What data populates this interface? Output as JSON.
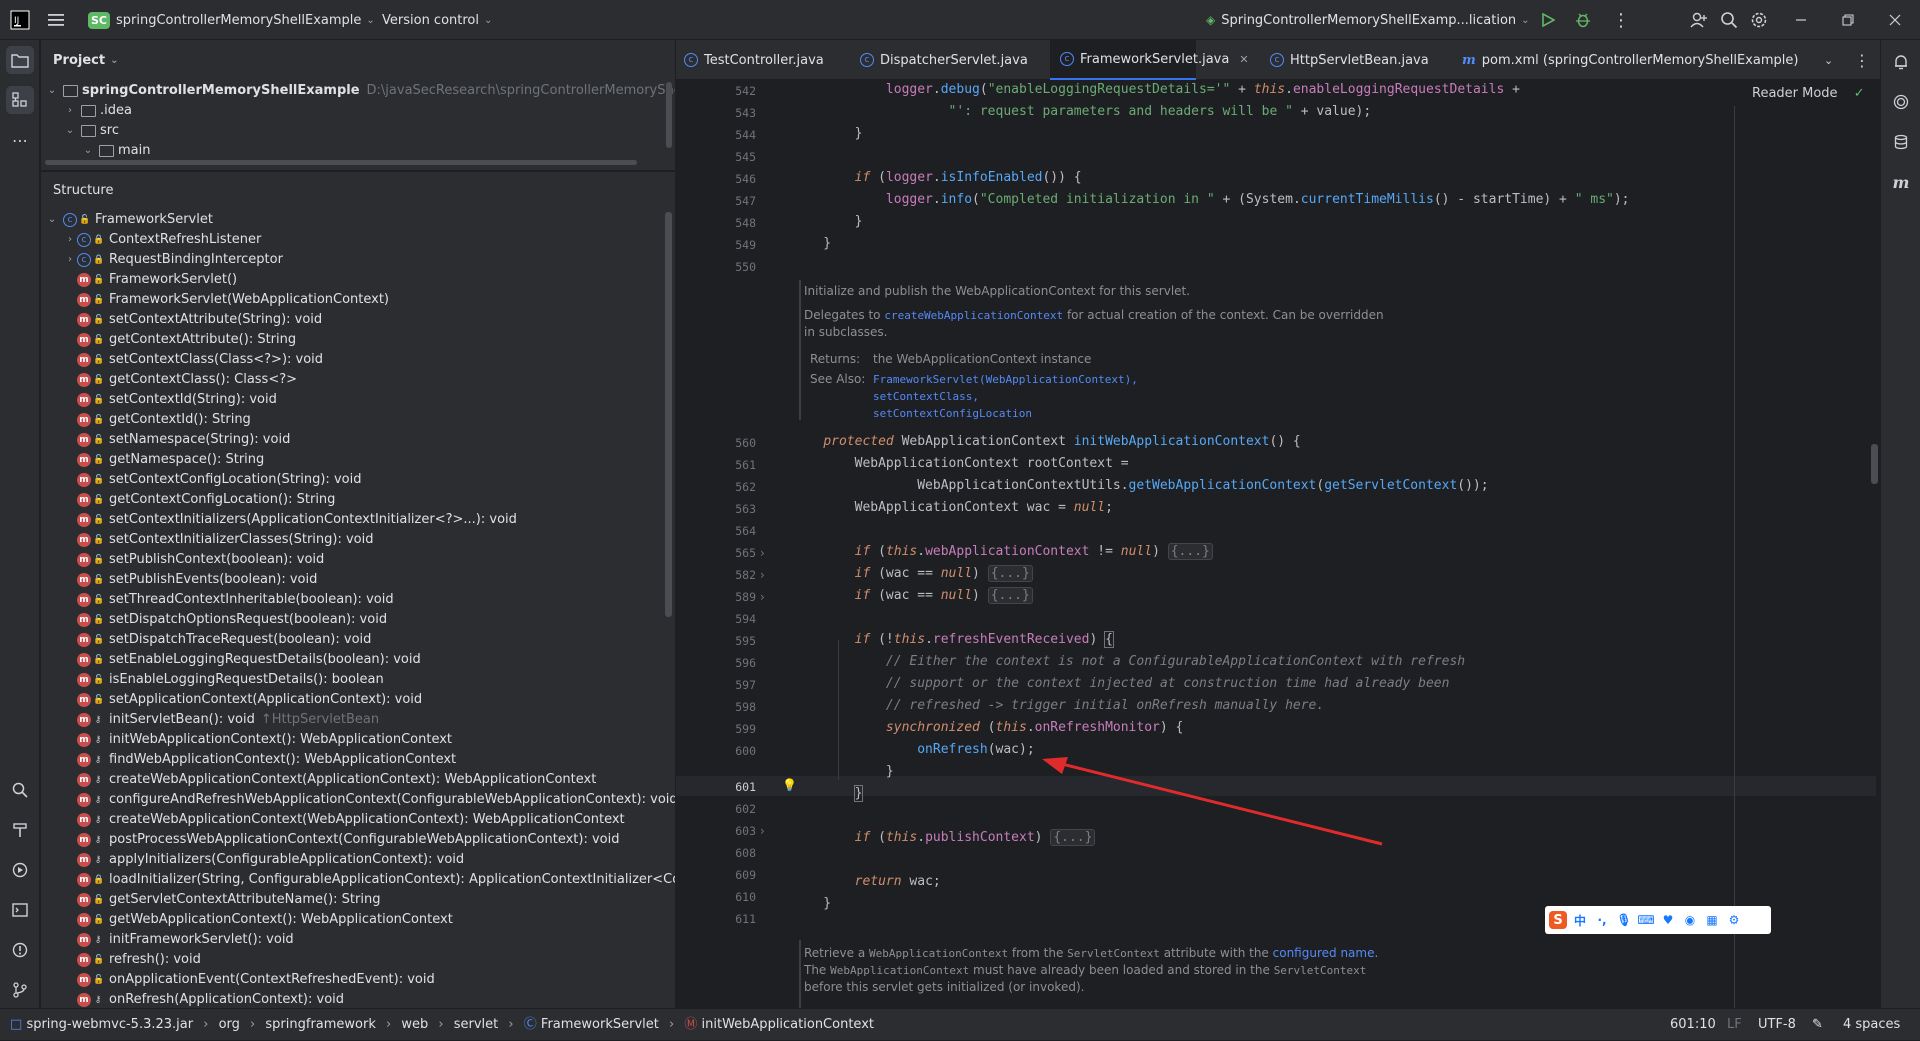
{
  "titlebar": {
    "project_badge": "SC",
    "project_name": "springControllerMemoryShellExample",
    "vcs": "Version control",
    "run_config": "SpringControllerMemoryShellExamp...lication"
  },
  "project_panel": {
    "title": "Project",
    "root_name": "springControllerMemoryShellExample",
    "root_path": "D:\\javaSecResearch\\springControllerMemoryShellExamp",
    "items": [
      ".idea",
      "src",
      "main"
    ]
  },
  "structure_panel": {
    "title": "Structure",
    "root": "FrameworkServlet",
    "items": [
      {
        "text": "ContextRefreshListener",
        "kind": "class",
        "vis": "lock",
        "hint": ""
      },
      {
        "text": "RequestBindingInterceptor",
        "kind": "class",
        "vis": "lock",
        "hint": ""
      },
      {
        "text": "FrameworkServlet()",
        "kind": "method",
        "vis": "open",
        "hint": ""
      },
      {
        "text": "FrameworkServlet(WebApplicationContext)",
        "kind": "method",
        "vis": "open",
        "hint": ""
      },
      {
        "text": "setContextAttribute(String): void",
        "kind": "method",
        "vis": "open",
        "hint": ""
      },
      {
        "text": "getContextAttribute(): String",
        "kind": "method",
        "vis": "open",
        "hint": ""
      },
      {
        "text": "setContextClass(Class<?>): void",
        "kind": "method",
        "vis": "open",
        "hint": ""
      },
      {
        "text": "getContextClass(): Class<?>",
        "kind": "method",
        "vis": "open",
        "hint": ""
      },
      {
        "text": "setContextId(String): void",
        "kind": "method",
        "vis": "open",
        "hint": ""
      },
      {
        "text": "getContextId(): String",
        "kind": "method",
        "vis": "open",
        "hint": ""
      },
      {
        "text": "setNamespace(String): void",
        "kind": "method",
        "vis": "open",
        "hint": ""
      },
      {
        "text": "getNamespace(): String",
        "kind": "method",
        "vis": "open",
        "hint": ""
      },
      {
        "text": "setContextConfigLocation(String): void",
        "kind": "method",
        "vis": "open",
        "hint": ""
      },
      {
        "text": "getContextConfigLocation(): String",
        "kind": "method",
        "vis": "open",
        "hint": ""
      },
      {
        "text": "setContextInitializers(ApplicationContextInitializer<?>...): void",
        "kind": "method",
        "vis": "open",
        "hint": ""
      },
      {
        "text": "setContextInitializerClasses(String): void",
        "kind": "method",
        "vis": "open",
        "hint": ""
      },
      {
        "text": "setPublishContext(boolean): void",
        "kind": "method",
        "vis": "open",
        "hint": ""
      },
      {
        "text": "setPublishEvents(boolean): void",
        "kind": "method",
        "vis": "open",
        "hint": ""
      },
      {
        "text": "setThreadContextInheritable(boolean): void",
        "kind": "method",
        "vis": "open",
        "hint": ""
      },
      {
        "text": "setDispatchOptionsRequest(boolean): void",
        "kind": "method",
        "vis": "open",
        "hint": ""
      },
      {
        "text": "setDispatchTraceRequest(boolean): void",
        "kind": "method",
        "vis": "open",
        "hint": ""
      },
      {
        "text": "setEnableLoggingRequestDetails(boolean): void",
        "kind": "method",
        "vis": "open",
        "hint": ""
      },
      {
        "text": "isEnableLoggingRequestDetails(): boolean",
        "kind": "method",
        "vis": "open",
        "hint": ""
      },
      {
        "text": "setApplicationContext(ApplicationContext): void",
        "kind": "method",
        "vis": "open",
        "hint": ""
      },
      {
        "text": "initServletBean(): void",
        "kind": "method",
        "vis": "key",
        "hint": "↑HttpServletBean"
      },
      {
        "text": "initWebApplicationContext(): WebApplicationContext",
        "kind": "method",
        "vis": "key",
        "hint": ""
      },
      {
        "text": "findWebApplicationContext(): WebApplicationContext",
        "kind": "method",
        "vis": "key",
        "hint": ""
      },
      {
        "text": "createWebApplicationContext(ApplicationContext): WebApplicationContext",
        "kind": "method",
        "vis": "key",
        "hint": ""
      },
      {
        "text": "configureAndRefreshWebApplicationContext(ConfigurableWebApplicationContext): void",
        "kind": "method",
        "vis": "key",
        "hint": ""
      },
      {
        "text": "createWebApplicationContext(WebApplicationContext): WebApplicationContext",
        "kind": "method",
        "vis": "key",
        "hint": ""
      },
      {
        "text": "postProcessWebApplicationContext(ConfigurableWebApplicationContext): void",
        "kind": "method",
        "vis": "key",
        "hint": ""
      },
      {
        "text": "applyInitializers(ConfigurableApplicationContext): void",
        "kind": "method",
        "vis": "key",
        "hint": ""
      },
      {
        "text": "loadInitializer(String, ConfigurableApplicationContext): ApplicationContextInitializer<Conf",
        "kind": "method",
        "vis": "lock",
        "hint": ""
      },
      {
        "text": "getServletContextAttributeName(): String",
        "kind": "method",
        "vis": "open",
        "hint": ""
      },
      {
        "text": "getWebApplicationContext(): WebApplicationContext",
        "kind": "method",
        "vis": "open",
        "hint": ""
      },
      {
        "text": "initFrameworkServlet(): void",
        "kind": "method",
        "vis": "key",
        "hint": ""
      },
      {
        "text": "refresh(): void",
        "kind": "method",
        "vis": "open",
        "hint": ""
      },
      {
        "text": "onApplicationEvent(ContextRefreshedEvent): void",
        "kind": "method",
        "vis": "open",
        "hint": ""
      },
      {
        "text": "onRefresh(ApplicationContext): void",
        "kind": "method",
        "vis": "key",
        "hint": ""
      }
    ]
  },
  "tabs": [
    {
      "label": "TestController.java",
      "active": false
    },
    {
      "label": "DispatcherServlet.java",
      "active": false
    },
    {
      "label": "FrameworkServlet.java",
      "active": true
    },
    {
      "label": "HttpServletBean.java",
      "active": false
    },
    {
      "label": "pom.xml (springControllerMemoryShellExample)",
      "active": false
    }
  ],
  "editor": {
    "reader_mode": "Reader Mode",
    "doc1": {
      "summary": "Initialize and publish the WebApplicationContext for this servlet.",
      "delegates_pre": "Delegates to ",
      "delegates_link": "createWebApplicationContext",
      "delegates_post": " for actual creation of the context. Can be overridden",
      "delegates_post2": "in subclasses.",
      "returns_label": "Returns:",
      "returns_text": "the WebApplicationContext instance",
      "see_label": "See Also:",
      "see_links": [
        "FrameworkServlet(WebApplicationContext),",
        "setContextClass,",
        "setContextConfigLocation"
      ]
    },
    "doc2": {
      "l1_pre": "Retrieve a ",
      "l1_code": "WebApplicationContext",
      "l1_mid": " from the ",
      "l1_code2": "ServletContext",
      "l1_mid2": " attribute with the ",
      "l1_link": "configured name",
      "l1_end": ".",
      "l2_pre": "The ",
      "l2_code": "WebApplicationContext",
      "l2_mid": " must have already been loaded and stored in the ",
      "l2_code2": "ServletContext",
      "l3": "before this servlet gets initialized (or invoked)."
    },
    "line_numbers": {
      "l542": "542",
      "l543": "543",
      "l544": "544",
      "l545": "545",
      "l546": "546",
      "l547": "547",
      "l548": "548",
      "l549": "549",
      "l550": "550",
      "l560": "560",
      "l561": "561",
      "l562": "562",
      "l563": "563",
      "l564": "564",
      "l565": "565",
      "l582": "582",
      "l589": "589",
      "l594": "594",
      "l595": "595",
      "l596": "596",
      "l597": "597",
      "l598": "598",
      "l599": "599",
      "l600": "600",
      "l601": "601",
      "l602": "602",
      "l603": "603",
      "l608": "608",
      "l609": "609",
      "l610": "610",
      "l611": "611"
    },
    "strings": {
      "s542": "\"enableLoggingRequestDetails='\"",
      "s543": "\"': request parameters and headers will be \"",
      "s547a": "\"Completed initialization in \"",
      "s547b": "\" ms\""
    },
    "comments": {
      "c595": "// Either the context is not a ConfigurableApplicationContext with refresh",
      "c596": "// support or the context injected at construction time had already been",
      "c597": "// refreshed -> trigger initial onRefresh manually here."
    },
    "folded": "{...}"
  },
  "statusbar": {
    "crumbs": [
      "spring-webmvc-5.3.23.jar",
      "org",
      "springframework",
      "web",
      "servlet",
      "FrameworkServlet",
      "initWebApplicationContext"
    ],
    "position": "601:10",
    "line_sep": "LF",
    "encoding": "UTF-8",
    "indent": "4 spaces"
  },
  "ime": {
    "logo": "S",
    "mode": "中"
  },
  "colors": {
    "accent": "#3574f0",
    "arrow": "#e02b2b",
    "method_icon": "#c94f4f"
  }
}
